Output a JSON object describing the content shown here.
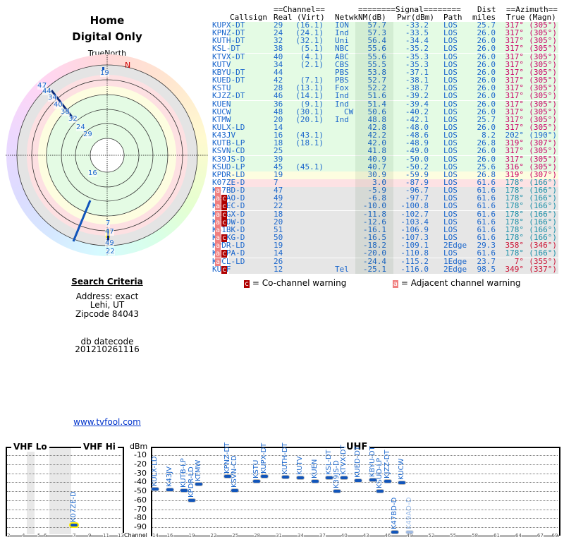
{
  "header": {
    "title": "Home",
    "subtitle": "Digital Only"
  },
  "polar": {
    "north_label": "TrueNorth",
    "n_marker": "N",
    "labels": [
      "19",
      "42",
      "7",
      "44",
      "34",
      "40",
      "38",
      "32",
      "24",
      "29",
      "16",
      "7",
      "47",
      "49",
      "22"
    ]
  },
  "criteria": {
    "heading": "Search Criteria",
    "address": "Address: exact",
    "city": "Lehi, UT",
    "zipcode": "Zipcode 84043",
    "db_label": "db datecode",
    "db_value": "201210261116"
  },
  "link": "www.tvfool.com",
  "table": {
    "group_headers": {
      "channel": "==Channel==",
      "signal": "========Signal========",
      "dist": "Dist",
      "azimuth": "==Azimuth=="
    },
    "columns": [
      "Callsign",
      "Real",
      "(Virt)",
      "Netwk",
      "NM(dB)",
      "Pwr(dBm)",
      "Path",
      "miles",
      "True",
      "(Magn)"
    ],
    "rows": [
      {
        "call": "KUPX-DT",
        "real": "29",
        "virt": "(16.1)",
        "net": "ION",
        "nm": "57.7",
        "pwr": "-33.2",
        "path": "LOS",
        "dist": "25.7",
        "true": "317°",
        "magn": "(305°)",
        "band": "green",
        "flags": ""
      },
      {
        "call": "KPNZ-DT",
        "real": "24",
        "virt": "(24.1)",
        "net": "Ind",
        "nm": "57.3",
        "pwr": "-33.5",
        "path": "LOS",
        "dist": "26.0",
        "true": "317°",
        "magn": "(305°)",
        "band": "green",
        "flags": ""
      },
      {
        "call": "KUTH-DT",
        "real": "32",
        "virt": "(32.1)",
        "net": "Uni",
        "nm": "56.4",
        "pwr": "-34.4",
        "path": "LOS",
        "dist": "26.0",
        "true": "317°",
        "magn": "(305°)",
        "band": "green",
        "flags": ""
      },
      {
        "call": "KSL-DT",
        "real": "38",
        "virt": "(5.1)",
        "net": "NBC",
        "nm": "55.6",
        "pwr": "-35.2",
        "path": "LOS",
        "dist": "26.0",
        "true": "317°",
        "magn": "(305°)",
        "band": "green",
        "flags": ""
      },
      {
        "call": "KTVX-DT",
        "real": "40",
        "virt": "(4.1)",
        "net": "ABC",
        "nm": "55.6",
        "pwr": "-35.3",
        "path": "LOS",
        "dist": "26.0",
        "true": "317°",
        "magn": "(305°)",
        "band": "green",
        "flags": ""
      },
      {
        "call": "KUTV",
        "real": "34",
        "virt": "(2.1)",
        "net": "CBS",
        "nm": "55.5",
        "pwr": "-35.3",
        "path": "LOS",
        "dist": "26.0",
        "true": "317°",
        "magn": "(305°)",
        "band": "green",
        "flags": ""
      },
      {
        "call": "KBYU-DT",
        "real": "44",
        "virt": "",
        "net": "PBS",
        "nm": "53.8",
        "pwr": "-37.1",
        "path": "LOS",
        "dist": "26.0",
        "true": "317°",
        "magn": "(305°)",
        "band": "green",
        "flags": ""
      },
      {
        "call": "KUED-DT",
        "real": "42",
        "virt": "(7.1)",
        "net": "PBS",
        "nm": "52.7",
        "pwr": "-38.1",
        "path": "LOS",
        "dist": "26.0",
        "true": "317°",
        "magn": "(305°)",
        "band": "green",
        "flags": ""
      },
      {
        "call": "KSTU",
        "real": "28",
        "virt": "(13.1)",
        "net": "Fox",
        "nm": "52.2",
        "pwr": "-38.7",
        "path": "LOS",
        "dist": "26.0",
        "true": "317°",
        "magn": "(305°)",
        "band": "green",
        "flags": ""
      },
      {
        "call": "KJZZ-DT",
        "real": "46",
        "virt": "(14.1)",
        "net": "Ind",
        "nm": "51.6",
        "pwr": "-39.2",
        "path": "LOS",
        "dist": "26.0",
        "true": "317°",
        "magn": "(305°)",
        "band": "green",
        "flags": ""
      },
      {
        "call": "KUEN",
        "real": "36",
        "virt": "(9.1)",
        "net": "Ind",
        "nm": "51.4",
        "pwr": "-39.4",
        "path": "LOS",
        "dist": "26.0",
        "true": "317°",
        "magn": "(305°)",
        "band": "green",
        "flags": ""
      },
      {
        "call": "KUCW",
        "real": "48",
        "virt": "(30.1)",
        "net": "CW",
        "nm": "50.6",
        "pwr": "-40.2",
        "path": "LOS",
        "dist": "26.0",
        "true": "317°",
        "magn": "(305°)",
        "band": "green",
        "flags": ""
      },
      {
        "call": "KTMW",
        "real": "20",
        "virt": "(20.1)",
        "net": "Ind",
        "nm": "48.8",
        "pwr": "-42.1",
        "path": "LOS",
        "dist": "25.7",
        "true": "317°",
        "magn": "(305°)",
        "band": "green",
        "flags": ""
      },
      {
        "call": "KULX-LD",
        "real": "14",
        "virt": "",
        "net": "",
        "nm": "42.8",
        "pwr": "-48.0",
        "path": "LOS",
        "dist": "26.0",
        "true": "317°",
        "magn": "(305°)",
        "band": "green",
        "flags": ""
      },
      {
        "call": "K43JV",
        "real": "16",
        "virt": "(43.1)",
        "net": "",
        "nm": "42.2",
        "pwr": "-48.6",
        "path": "LOS",
        "dist": "8.2",
        "true": "202°",
        "magn": "(190°)",
        "band": "green",
        "flags": ""
      },
      {
        "call": "KUTB-LP",
        "real": "18",
        "virt": "(18.1)",
        "net": "",
        "nm": "42.0",
        "pwr": "-48.9",
        "path": "LOS",
        "dist": "26.8",
        "true": "319°",
        "magn": "(307°)",
        "band": "green",
        "flags": ""
      },
      {
        "call": "KSVN-CD",
        "real": "25",
        "virt": "",
        "net": "",
        "nm": "41.8",
        "pwr": "-49.0",
        "path": "LOS",
        "dist": "26.0",
        "true": "317°",
        "magn": "(305°)",
        "band": "green",
        "flags": ""
      },
      {
        "call": "K39JS-D",
        "real": "39",
        "virt": "",
        "net": "",
        "nm": "40.9",
        "pwr": "-50.0",
        "path": "LOS",
        "dist": "26.0",
        "true": "317°",
        "magn": "(305°)",
        "band": "green",
        "flags": ""
      },
      {
        "call": "KSUD-LP",
        "real": "45",
        "virt": "(45.1)",
        "net": "",
        "nm": "40.7",
        "pwr": "-50.2",
        "path": "LOS",
        "dist": "25.6",
        "true": "316°",
        "magn": "(305°)",
        "band": "green",
        "flags": ""
      },
      {
        "call": "KPDR-LD",
        "real": "19",
        "virt": "",
        "net": "",
        "nm": "30.9",
        "pwr": "-59.9",
        "path": "LOS",
        "dist": "26.8",
        "true": "319°",
        "magn": "(307°)",
        "band": "yellow",
        "flags": ""
      },
      {
        "call": "K07ZE-D",
        "real": "7",
        "virt": "",
        "net": "",
        "nm": "3.0",
        "pwr": "-87.9",
        "path": "LOS",
        "dist": "61.6",
        "true": "178°",
        "magn": "(166°)",
        "band": "pink",
        "flags": ""
      },
      {
        "call": "K47BD-D",
        "real": "47",
        "virt": "",
        "net": "",
        "nm": "-5.9",
        "pwr": "-96.7",
        "path": "LOS",
        "dist": "61.6",
        "true": "178°",
        "magn": "(166°)",
        "band": "gray",
        "flags": "a"
      },
      {
        "call": "K49AO-D",
        "real": "49",
        "virt": "",
        "net": "",
        "nm": "-6.8",
        "pwr": "-97.7",
        "path": "LOS",
        "dist": "61.6",
        "true": "178°",
        "magn": "(166°)",
        "band": "gray",
        "flags": "ac"
      },
      {
        "call": "K22EC-D",
        "real": "22",
        "virt": "",
        "net": "",
        "nm": "-10.0",
        "pwr": "-100.8",
        "path": "LOS",
        "dist": "61.6",
        "true": "178°",
        "magn": "(166°)",
        "band": "gray",
        "flags": "ac"
      },
      {
        "call": "K18GX-D",
        "real": "18",
        "virt": "",
        "net": "",
        "nm": "-11.8",
        "pwr": "-102.7",
        "path": "LOS",
        "dist": "61.6",
        "true": "178°",
        "magn": "(166°)",
        "band": "gray",
        "flags": "ac"
      },
      {
        "call": "K20DW-D",
        "real": "20",
        "virt": "",
        "net": "",
        "nm": "-12.6",
        "pwr": "-103.4",
        "path": "LOS",
        "dist": "61.6",
        "true": "178°",
        "magn": "(166°)",
        "band": "gray",
        "flags": "ac"
      },
      {
        "call": "K51BK-D",
        "real": "51",
        "virt": "",
        "net": "",
        "nm": "-16.1",
        "pwr": "-106.9",
        "path": "LOS",
        "dist": "61.6",
        "true": "178°",
        "magn": "(166°)",
        "band": "gray",
        "flags": "a"
      },
      {
        "call": "K50KG-D",
        "real": "50",
        "virt": "",
        "net": "",
        "nm": "-16.5",
        "pwr": "-107.3",
        "path": "LOS",
        "dist": "61.6",
        "true": "178°",
        "magn": "(166°)",
        "band": "gray",
        "flags": "ac"
      },
      {
        "call": "KPDR-LD",
        "real": "19",
        "virt": "",
        "net": "",
        "nm": "-18.2",
        "pwr": "-109.1",
        "path": "2Edge",
        "dist": "29.3",
        "true": "358°",
        "magn": "(346°)",
        "band": "gray",
        "flags": "a"
      },
      {
        "call": "K14PA-D",
        "real": "14",
        "virt": "",
        "net": "",
        "nm": "-20.0",
        "pwr": "-110.8",
        "path": "LOS",
        "dist": "61.6",
        "true": "178°",
        "magn": "(166°)",
        "band": "gray",
        "flags": "ac"
      },
      {
        "call": "KUCL-LD",
        "real": "26",
        "virt": "",
        "net": "",
        "nm": "-24.4",
        "pwr": "-115.2",
        "path": "1Edge",
        "dist": "23.7",
        "true": "7°",
        "magn": "(355°)",
        "band": "gray",
        "flags": "a"
      },
      {
        "call": "KUTF",
        "real": "12",
        "virt": "",
        "net": "Tel",
        "nm": "-25.1",
        "pwr": "-116.0",
        "path": "2Edge",
        "dist": "98.5",
        "true": "349°",
        "magn": "(337°)",
        "band": "gray",
        "flags": "c"
      }
    ],
    "legend": {
      "co_flag": "c",
      "co_text": "= Co-channel warning",
      "adj_flag": "a",
      "adj_text": "= Adjacent channel warning"
    },
    "colors": {
      "green": "#e4fbe4",
      "yellow": "#fdfde0",
      "pink": "#fde2e4",
      "gray": "#e6e6e6",
      "text": "#1a66cc",
      "az_magenta": "#cc0066",
      "az_teal": "#1a8fa8",
      "az_red": "#cc1133"
    }
  },
  "chart_data": {
    "type": "scatter",
    "ylabel": "dBm",
    "xlabel": "Channel",
    "ylim": [
      -95,
      -5
    ],
    "yticks": [
      "-10",
      "-20",
      "-30",
      "-40",
      "-50",
      "-60",
      "-70",
      "-80",
      "-90"
    ],
    "sections": [
      "VHF Lo",
      "VHF Hi",
      "UHF"
    ],
    "vhf_ticks": [
      "2",
      "4",
      "5",
      "6",
      "7",
      "9",
      "11",
      "13"
    ],
    "uhf_ticks": [
      "14",
      "16",
      "19",
      "22",
      "25",
      "28",
      "31",
      "34",
      "37",
      "40",
      "43",
      "46",
      "49",
      "52",
      "55",
      "58",
      "61",
      "64",
      "67",
      "69"
    ],
    "points": [
      {
        "label": "K07ZE-D",
        "ch": 7,
        "dbm": -87.9,
        "highlight": true
      },
      {
        "label": "KULX-LD",
        "ch": 14,
        "dbm": -48.0
      },
      {
        "label": "K43JV",
        "ch": 16,
        "dbm": -48.6
      },
      {
        "label": "KUTB-LP",
        "ch": 18,
        "dbm": -48.9
      },
      {
        "label": "KPDR-LD",
        "ch": 19,
        "dbm": -59.9
      },
      {
        "label": "KTMW",
        "ch": 20,
        "dbm": -42.1
      },
      {
        "label": "KPNZ-DT",
        "ch": 24,
        "dbm": -33.5
      },
      {
        "label": "KSVN-CD",
        "ch": 25,
        "dbm": -49.0
      },
      {
        "label": "KSTU",
        "ch": 28,
        "dbm": -38.7
      },
      {
        "label": "KUPX-DT",
        "ch": 29,
        "dbm": -33.2
      },
      {
        "label": "KUTH-DT",
        "ch": 32,
        "dbm": -34.4
      },
      {
        "label": "KUTV",
        "ch": 34,
        "dbm": -35.3
      },
      {
        "label": "KUEN",
        "ch": 36,
        "dbm": -39.4
      },
      {
        "label": "KSL-DT",
        "ch": 38,
        "dbm": -35.2
      },
      {
        "label": "K39JS-D",
        "ch": 39,
        "dbm": -50.0
      },
      {
        "label": "KTVX-DT",
        "ch": 40,
        "dbm": -35.3
      },
      {
        "label": "KUED-DT",
        "ch": 42,
        "dbm": -38.1
      },
      {
        "label": "KBYU-DT",
        "ch": 44,
        "dbm": -37.1
      },
      {
        "label": "KSUD-LP",
        "ch": 45,
        "dbm": -50.2
      },
      {
        "label": "KJZZ-DT",
        "ch": 46,
        "dbm": -39.2
      },
      {
        "label": "K47BD-D",
        "ch": 47,
        "dbm": -96.7
      },
      {
        "label": "KUCW",
        "ch": 48,
        "dbm": -40.2
      },
      {
        "label": "K49AO-D",
        "ch": 49,
        "dbm": -97.7,
        "faded": true
      }
    ]
  }
}
